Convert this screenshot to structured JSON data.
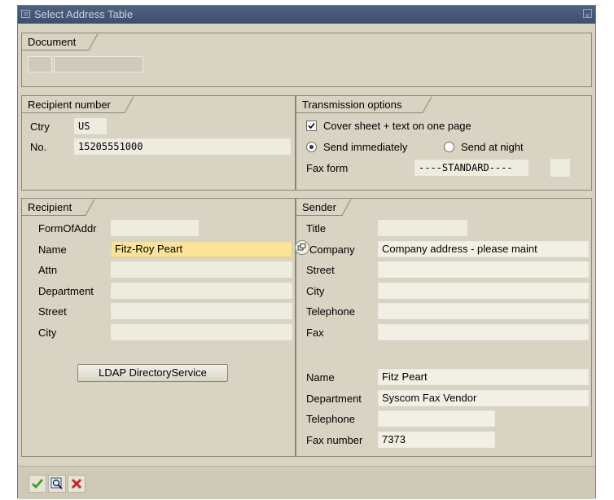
{
  "window": {
    "title": "Select Address Table"
  },
  "document": {
    "section_label": "Document"
  },
  "recipient_number": {
    "section_label": "Recipient number",
    "ctry_label": "Ctry",
    "ctry_value": "US",
    "no_label": "No.",
    "no_value": "15205551000"
  },
  "transmission": {
    "section_label": "Transmission options",
    "cover_sheet_label": "Cover sheet + text on one page",
    "cover_sheet_checked": true,
    "send_immediately_label": "Send immediately",
    "send_at_night_label": "Send at night",
    "selected_send": "Send immediately",
    "fax_form_label": "Fax form",
    "fax_form_value": "----STANDARD----"
  },
  "recipient": {
    "section_label": "Recipient",
    "formofaddr_label": "FormOfAddr",
    "formofaddr_value": "",
    "name_label": "Name",
    "name_value": "Fitz-Roy Peart",
    "attn_label": "Attn",
    "attn_value": "",
    "department_label": "Department",
    "department_value": "",
    "street_label": "Street",
    "street_value": "",
    "city_label": "City",
    "city_value": "",
    "ldap_button": "LDAP DirectoryService"
  },
  "sender": {
    "section_label": "Sender",
    "title_label": "Title",
    "title_value": "",
    "company_label": "Company",
    "company_value": "Company address - please maint",
    "street_label": "Street",
    "street_value": "",
    "city_label": "City",
    "city_value": "",
    "telephone_label": "Telephone",
    "telephone_value": "",
    "fax_label": "Fax",
    "fax_value": "",
    "name_label": "Name",
    "name_value": "Fitz Peart",
    "department_label": "Department",
    "department_value": "Syscom Fax Vendor",
    "telephone2_label": "Telephone",
    "telephone2_value": "",
    "faxnumber_label": "Fax number",
    "faxnumber_value": "7373"
  },
  "toolbar": {
    "icons": [
      "checkmark-icon",
      "search-icon",
      "cancel-icon"
    ],
    "colors": {
      "check": "#2e9a2e",
      "cancel": "#c0282a"
    }
  }
}
